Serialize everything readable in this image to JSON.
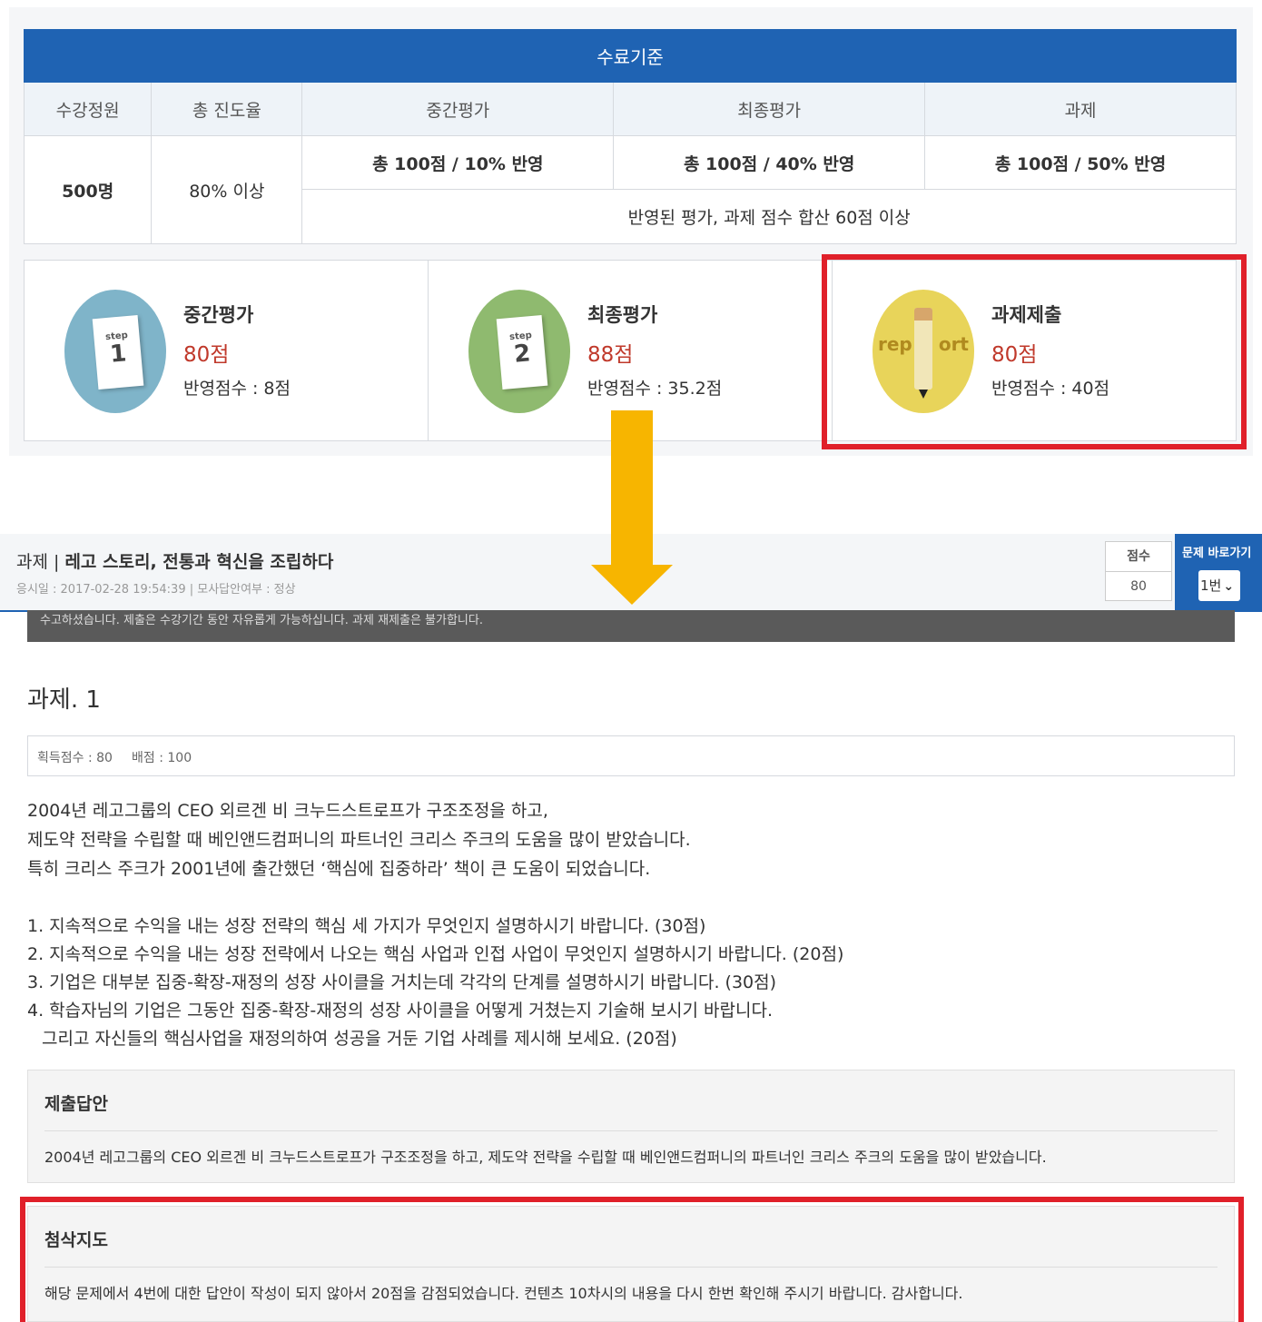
{
  "criteria": {
    "header": "수료기준",
    "columns": [
      "수강정원",
      "총 진도율",
      "중간평가",
      "최종평가",
      "과제"
    ],
    "capacity": "500명",
    "progress": "80% 이상",
    "midterm": "총 100점 / 10% 반영",
    "final": "총 100점 / 40% 반영",
    "assignment": "총 100점 / 50% 반영",
    "total_rule": "반영된 평가, 과제 점수 합산 60점 이상"
  },
  "cards": [
    {
      "step_label": "step",
      "step_num": "1",
      "title": "중간평가",
      "score": "80점",
      "reflect": "반영점수 : 8점"
    },
    {
      "step_label": "step",
      "step_num": "2",
      "title": "최종평가",
      "score": "88점",
      "reflect": "반영점수 : 35.2점"
    },
    {
      "icon_text_left": "rep",
      "icon_text_right": "ort",
      "title": "과제제출",
      "score": "80점",
      "reflect": "반영점수 : 40점"
    }
  ],
  "colors": {
    "accent": "#1f63b3",
    "highlight": "#e0202a",
    "arrow": "#f7b500",
    "score_red": "#c0392b"
  },
  "detail_header": {
    "title_label": "과제 | ",
    "title": "레고 스토리, 전통과 혁신을 조립하다",
    "meta": "응시일 : 2017-02-28 19:54:39  |  모사답안여부 : 정상",
    "score_label": "점수",
    "score_value": "80",
    "goto_label": "문제 바로가기",
    "goto_selected": "1번"
  },
  "notice_strip": "수고하셨습니다. 제출은 수강기간 동안 자유롭게 가능하십니다. 과제 재제출은 불가합니다.",
  "assignment": {
    "title": "과제. 1",
    "earned": "획득점수 : 80",
    "points": "배점 : 100",
    "description": [
      "2004년 레고그룹의 CEO 외르겐 비 크누드스트로프가 구조조정을 하고,",
      "제도약 전략을 수립할 때 베인앤드컴퍼니의 파트너인 크리스 주크의 도움을 많이 받았습니다.",
      "특히 크리스 주크가 2001년에 출간했던 ‘핵심에 집중하라’ 책이 큰 도움이 되었습니다."
    ],
    "questions": [
      "1. 지속적으로 수익을 내는 성장 전략의 핵심 세 가지가 무엇인지 설명하시기 바랍니다. (30점)",
      "2. 지속적으로 수익을 내는 성장 전략에서 나오는 핵심 사업과 인접 사업이 무엇인지 설명하시기 바랍니다. (20점)",
      "3. 기업은 대부분 집중-확장-재정의 성장 사이클을 거치는데 각각의 단계를 설명하시기 바랍니다. (30점)",
      "4. 학습자님의 기업은 그동안 집중-확장-재정의 성장 사이클을 어떻게 거쳤는지 기술해 보시기 바랍니다.",
      "그리고 자신들의 핵심사업을 재정의하여 성공을 거둔 기업 사례를 제시해 보세요. (20점)"
    ]
  },
  "submitted": {
    "heading": "제출답안",
    "text": "2004년 레고그룹의 CEO 외르겐 비 크누드스트로프가 구조조정을 하고, 제도약 전략을 수립할 때 베인앤드컴퍼니의 파트너인 크리스 주크의 도움을 많이 받았습니다."
  },
  "feedback": {
    "heading": "첨삭지도",
    "text": "해당 문제에서 4번에 대한 답안이 작성이 되지 않아서 20점을 감점되었습니다. 컨텐츠 10차시의 내용을 다시 한번 확인해 주시기 바랍니다. 감사합니다."
  }
}
